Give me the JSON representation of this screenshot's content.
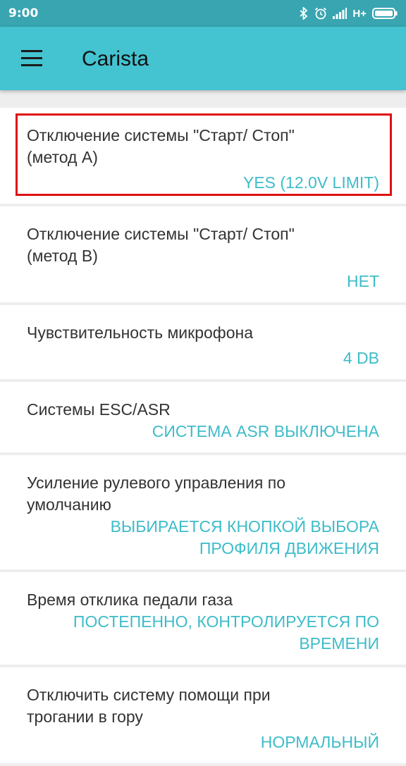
{
  "status_bar": {
    "time": "9:00",
    "network_type": "H+",
    "icons": [
      "bluetooth-icon",
      "alarm-icon",
      "signal-icon",
      "battery-icon"
    ]
  },
  "app_bar": {
    "title": "Carista",
    "menu_icon": "hamburger-menu-icon"
  },
  "settings": [
    {
      "label": "Отключение системы \"Старт/ Стоп\" (метод A)",
      "value": "YES (12.0V LIMIT)"
    },
    {
      "label": "Отключение системы \"Старт/ Стоп\" (метод B)",
      "value": "НЕТ"
    },
    {
      "label": "Чувствительность микрофона",
      "value": "4 DB"
    },
    {
      "label": "Системы ESC/ASR",
      "value": "СИСТЕМА ASR ВЫКЛЮЧЕНА"
    },
    {
      "label": "Усиление рулевого управления по умолчанию",
      "value": "ВЫБИРАЕТСЯ КНОПКОЙ ВЫБОРА ПРОФИЛЯ ДВИЖЕНИЯ"
    },
    {
      "label": "Время отклика педали газа",
      "value": "ПОСТЕПЕННО, КОНТРОЛИРУЕТСЯ ПО ВРЕМЕНИ"
    },
    {
      "label": "Отключить систему помощи при трогании в гору",
      "value": "НОРМАЛЬНЫЙ"
    }
  ],
  "colors": {
    "status_bar": "#38a5b1",
    "app_bar": "#44c3d0",
    "value_text": "#3ebcc9",
    "highlight_border": "#e01010"
  }
}
